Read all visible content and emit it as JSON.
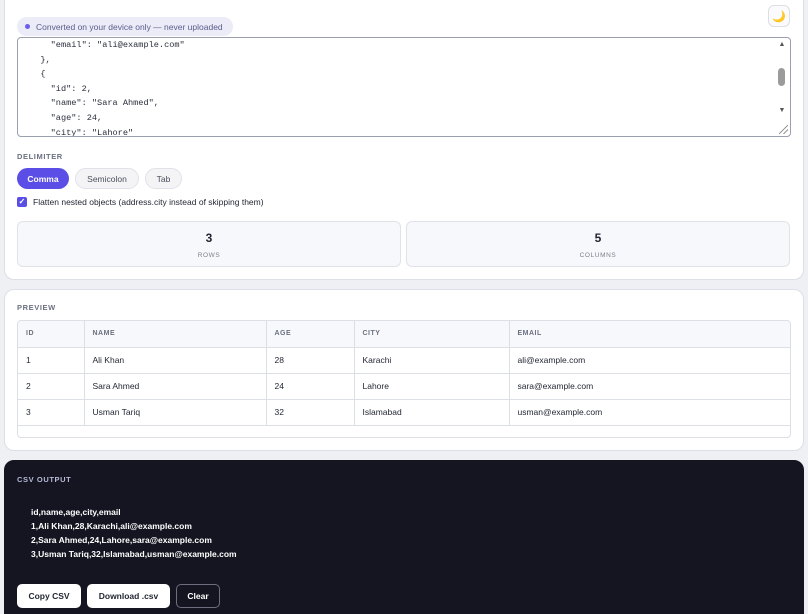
{
  "badge": {
    "text": "Converted on your device only — never uploaded"
  },
  "theme_toggle": {
    "icon": "moon-icon",
    "glyph": "🌙"
  },
  "input": {
    "json_text": "    \"email\": \"ali@example.com\"\n  },\n  {\n    \"id\": 2,\n    \"name\": \"Sara Ahmed\",\n    \"age\": 24,\n    \"city\": \"Lahore\""
  },
  "delimiter": {
    "label": "DELIMITER",
    "options": [
      "Comma",
      "Semicolon",
      "Tab"
    ],
    "selected": "Comma"
  },
  "flatten": {
    "checked": true,
    "label": "Flatten nested objects (address.city instead of skipping them)"
  },
  "stats": {
    "rows": {
      "value": "3",
      "label": "ROWS"
    },
    "columns": {
      "value": "5",
      "label": "COLUMNS"
    }
  },
  "preview": {
    "label": "PREVIEW",
    "headers": [
      "ID",
      "NAME",
      "AGE",
      "CITY",
      "EMAIL"
    ],
    "rows": [
      [
        "1",
        "Ali Khan",
        "28",
        "Karachi",
        "ali@example.com"
      ],
      [
        "2",
        "Sara Ahmed",
        "24",
        "Lahore",
        "sara@example.com"
      ],
      [
        "3",
        "Usman Tariq",
        "32",
        "Islamabad",
        "usman@example.com"
      ]
    ]
  },
  "output": {
    "label": "CSV OUTPUT",
    "lines": [
      "id,name,age,city,email",
      "1,Ali Khan,28,Karachi,ali@example.com",
      "2,Sara Ahmed,24,Lahore,sara@example.com",
      "3,Usman Tariq,32,Islamabad,usman@example.com"
    ]
  },
  "actions": {
    "copy_label": "Copy CSV",
    "download_label": "Download .csv",
    "clear_label": "Clear"
  },
  "colors": {
    "accent": "#5b4ee6",
    "output_bg": "#141521",
    "page_bg": "#eef0f3"
  }
}
